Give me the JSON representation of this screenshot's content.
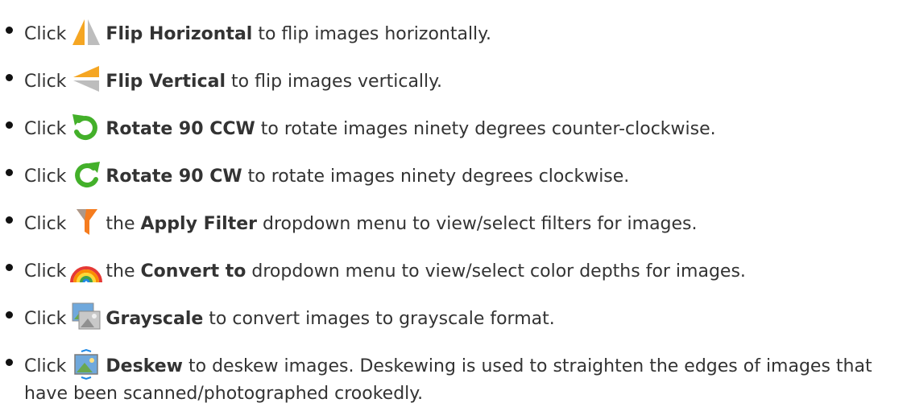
{
  "items": [
    {
      "click": "Click",
      "icon": "flip-horizontal-icon",
      "pre": "",
      "command": "Flip Horizontal",
      "post": "to flip images horizontally."
    },
    {
      "click": "Click",
      "icon": "flip-vertical-icon",
      "pre": "",
      "command": "Flip Vertical",
      "post": "to flip images vertically."
    },
    {
      "click": "Click",
      "icon": "rotate-ccw-icon",
      "pre": "",
      "command": "Rotate 90 CCW",
      "post": "to rotate images ninety degrees counter-clockwise."
    },
    {
      "click": "Click",
      "icon": "rotate-cw-icon",
      "pre": "",
      "command": "Rotate 90 CW",
      "post": "to rotate images ninety degrees clockwise."
    },
    {
      "click": "Click",
      "icon": "filter-icon",
      "pre": "the",
      "command": "Apply Filter",
      "post": "dropdown menu to view/select filters for images."
    },
    {
      "click": "Click",
      "icon": "rainbow-icon",
      "pre": "the",
      "command": "Convert to",
      "post": "dropdown menu to view/select color depths for images."
    },
    {
      "click": "Click",
      "icon": "grayscale-icon",
      "pre": "",
      "command": "Grayscale",
      "post": "to convert images to grayscale format."
    },
    {
      "click": "Click",
      "icon": "deskew-icon",
      "pre": "",
      "command": "Deskew",
      "post": "to deskew images. Deskewing is used to straighten the edges of images that have been scanned/photographed crookedly."
    }
  ],
  "colors": {
    "text": "#333333",
    "orange": "#f5a623",
    "gray": "#b8b8b8",
    "green": "#43b02a"
  }
}
